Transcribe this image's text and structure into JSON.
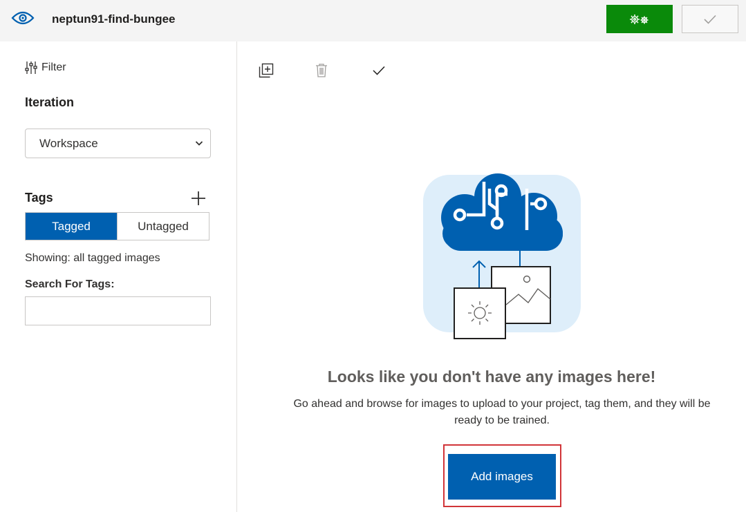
{
  "header": {
    "project_title": "neptun91-find-bungee",
    "train_icon": "gears-icon",
    "quick_test_icon": "checkmark-icon"
  },
  "sidebar": {
    "filter_label": "Filter",
    "iteration_label": "Iteration",
    "iteration_value": "Workspace",
    "tags_label": "Tags",
    "tag_toggle": {
      "tagged": "Tagged",
      "untagged": "Untagged",
      "selected": "Tagged"
    },
    "showing_text": "Showing: all tagged images",
    "search_label": "Search For Tags:",
    "search_value": ""
  },
  "toolbar": {
    "icons": [
      "add-images-icon",
      "delete-icon",
      "select-checkmark-icon"
    ]
  },
  "empty_state": {
    "title": "Looks like you don't have any images here!",
    "description": "Go ahead and browse for images to upload to your project, tag them, and they will be ready to be trained.",
    "add_button_label": "Add images"
  },
  "colors": {
    "accent": "#0060b0",
    "train_green": "#0a8a0a",
    "highlight_red": "#d13438",
    "illustration_bg": "#deeefa"
  }
}
